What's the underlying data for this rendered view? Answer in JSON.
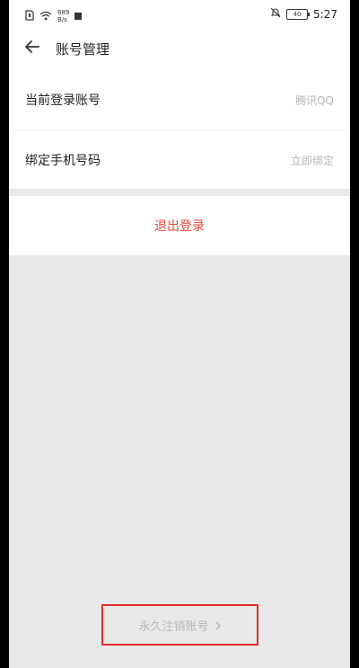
{
  "statusbar": {
    "net_speed_top": "689",
    "net_speed_bottom": "B/s",
    "battery": "40",
    "time": "5:27"
  },
  "header": {
    "title": "账号管理"
  },
  "settings": {
    "rows": [
      {
        "label": "当前登录账号",
        "value": "腾讯QQ"
      },
      {
        "label": "绑定手机号码",
        "value": "立即绑定"
      }
    ]
  },
  "logout_label": "退出登录",
  "delete_account_label": "永久注销账号",
  "colors": {
    "accent_red": "#e2483c",
    "highlight_box": "#e22b2b",
    "background": "#e9e9e9"
  }
}
